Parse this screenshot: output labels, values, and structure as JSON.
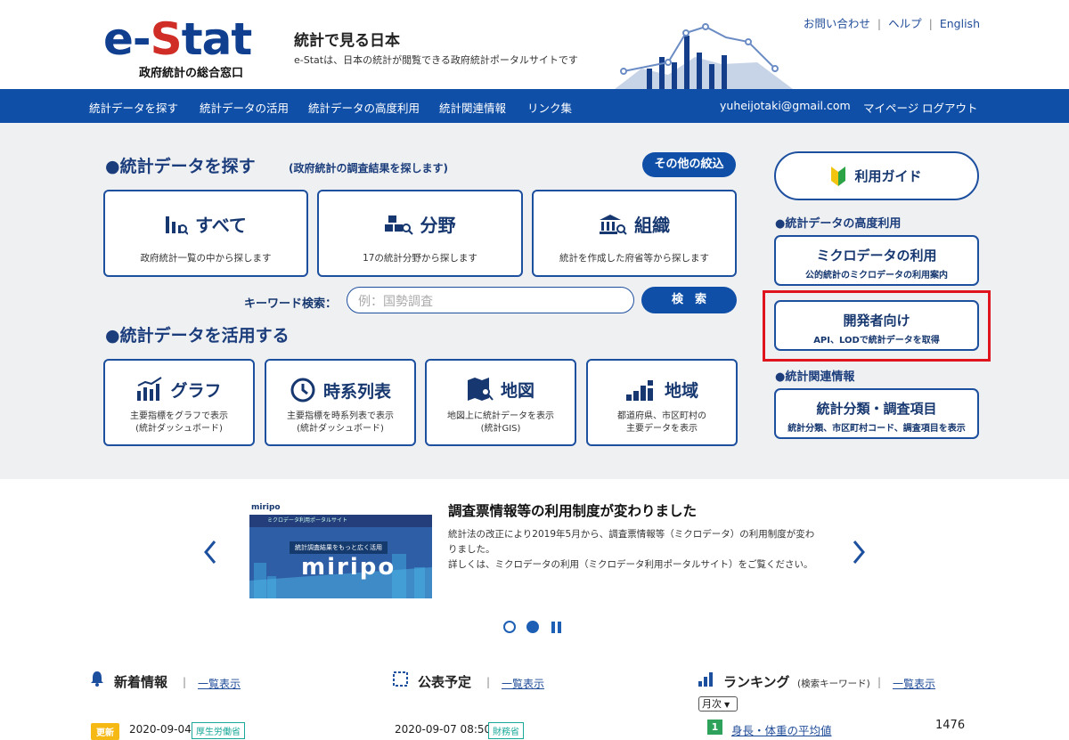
{
  "header": {
    "logo_left": "e-",
    "logo_red": "S",
    "logo_right": "tat",
    "logo_sub": "政府統計の総合窓口",
    "title": "統計で見る日本",
    "desc": "e-Statは、日本の統計が閲覧できる政府統計ポータルサイトです",
    "links": [
      "お問い合わせ",
      "ヘルプ",
      "English"
    ]
  },
  "nav": {
    "items": [
      "統計データを探す",
      "統計データの活用",
      "統計データの高度利用",
      "統計関連情報",
      "リンク集"
    ],
    "email": "yuheijotaki@gmail.com",
    "mypage": "マイページ",
    "logout": "ログアウト"
  },
  "search_section": {
    "title": "●統計データを探す",
    "subtitle": "(政府統計の調査結果を探します)",
    "filter_button": "その他の絞込",
    "cards": [
      {
        "title": "すべて",
        "desc": "政府統計一覧の中から探します"
      },
      {
        "title": "分野",
        "desc": "17の統計分野から探します"
      },
      {
        "title": "組織",
        "desc": "統計を作成した府省等から探します"
      }
    ],
    "keyword_label": "キーワード検索：",
    "keyword_placeholder": "例：国勢調査",
    "search_button": "検　索"
  },
  "use_section": {
    "title": "●統計データを活用する",
    "cards": [
      {
        "title": "グラフ",
        "desc1": "主要指標をグラフで表示",
        "desc2": "(統計ダッシュボード)"
      },
      {
        "title": "時系列表",
        "desc1": "主要指標を時系列表で表示",
        "desc2": "(統計ダッシュボード)"
      },
      {
        "title": "地図",
        "desc1": "地図上に統計データを表示",
        "desc2": "(統計GIS)"
      },
      {
        "title": "地域",
        "desc1": "都道府県、市区町村の",
        "desc2": "主要データを表示"
      }
    ]
  },
  "sidebar": {
    "guide": "利用ガイド",
    "advanced_label": "●統計データの高度利用",
    "micro_title": "ミクロデータの利用",
    "micro_desc": "公的統計のミクロデータの利用案内",
    "dev_title": "開発者向け",
    "dev_desc": "API、LODで統計データを取得",
    "related_label": "●統計関連情報",
    "class_title": "統計分類・調査項目",
    "class_desc": "統計分類、市区町村コード、調査項目を表示",
    "highlight_color": "#e0141e"
  },
  "news": {
    "image_logo": "miripo",
    "image_tagline": "統計調査結果をもっと広く活用",
    "image_nav_label": "ミクロデータ利用ポータルサイト",
    "title": "調査票情報等の利用制度が変わりました",
    "body1": "統計法の改正により2019年5月から、調査票情報等（ミクロデータ）の利用制度が変わりました。",
    "body2": "詳しくは、ミクロデータの利用（ミクロデータ利用ポータルサイト）をご覧ください。"
  },
  "bottom": {
    "col1_title": "新着情報",
    "col2_title": "公表予定",
    "col3_title": "ランキング",
    "col3_sub": "(検索キーワード)",
    "list_link": "一覧表示",
    "new_tag": "更新",
    "new_date": "2020-09-04",
    "new_ministry": "厚生労働省",
    "sched_date": "2020-09-07 08:50",
    "sched_ministry": "財務省",
    "rank_select": "月次",
    "rank_num": "1",
    "rank_item": "身長・体重の平均値",
    "rank_count": "1476"
  }
}
